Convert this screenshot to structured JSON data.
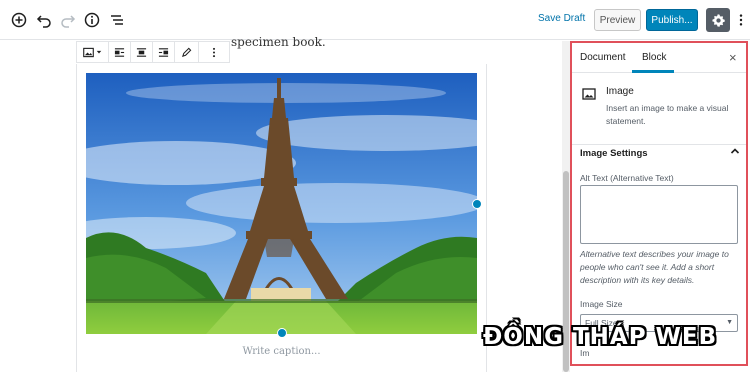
{
  "topbar": {
    "save_draft": "Save Draft",
    "preview": "Preview",
    "publish": "Publish...",
    "accent": "#0085ba"
  },
  "editor": {
    "paragraph_text": "specimen book.",
    "caption_placeholder": "Write caption..."
  },
  "sidebar": {
    "tabs": [
      {
        "label": "Document"
      },
      {
        "label": "Block"
      }
    ],
    "close_icon": "×",
    "block": {
      "title": "Image",
      "description": "Insert an image to make a visual statement."
    },
    "panel": {
      "title": "Image Settings",
      "alt_label": "Alt Text (Alternative Text)",
      "alt_value": "",
      "alt_help": "Alternative text describes your image to people who can't see it. Add a short description with its key details.",
      "size_label": "Image Size",
      "size_value": "Full Size",
      "next_label": "Im"
    }
  },
  "watermark": "ĐỒNG THÁP WEB"
}
